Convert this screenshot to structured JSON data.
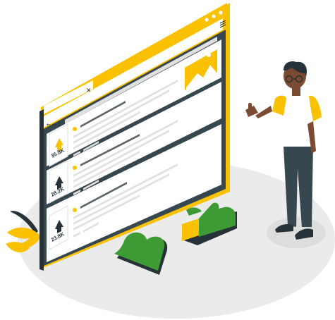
{
  "browser": {
    "close_glyph": "✕",
    "nav_glyphs": "← → C",
    "menu_icon": "hamburger-menu-icon"
  },
  "posts": [
    {
      "vote_count": "35.8K",
      "vote_icon": "upvote-arrow-icon",
      "vote_color": "#F9C100",
      "has_image": true
    },
    {
      "vote_count": "28.2K",
      "vote_icon": "upvote-arrow-icon",
      "vote_color": "#263238",
      "has_image": true
    },
    {
      "vote_count": "23.8K",
      "vote_icon": "upvote-arrow-icon",
      "vote_color": "#263238",
      "has_image": false
    }
  ],
  "colors": {
    "accent_yellow": "#F9C100",
    "dark": "#263238",
    "green": "#3D9A34",
    "floor": "#EBEBEB"
  }
}
